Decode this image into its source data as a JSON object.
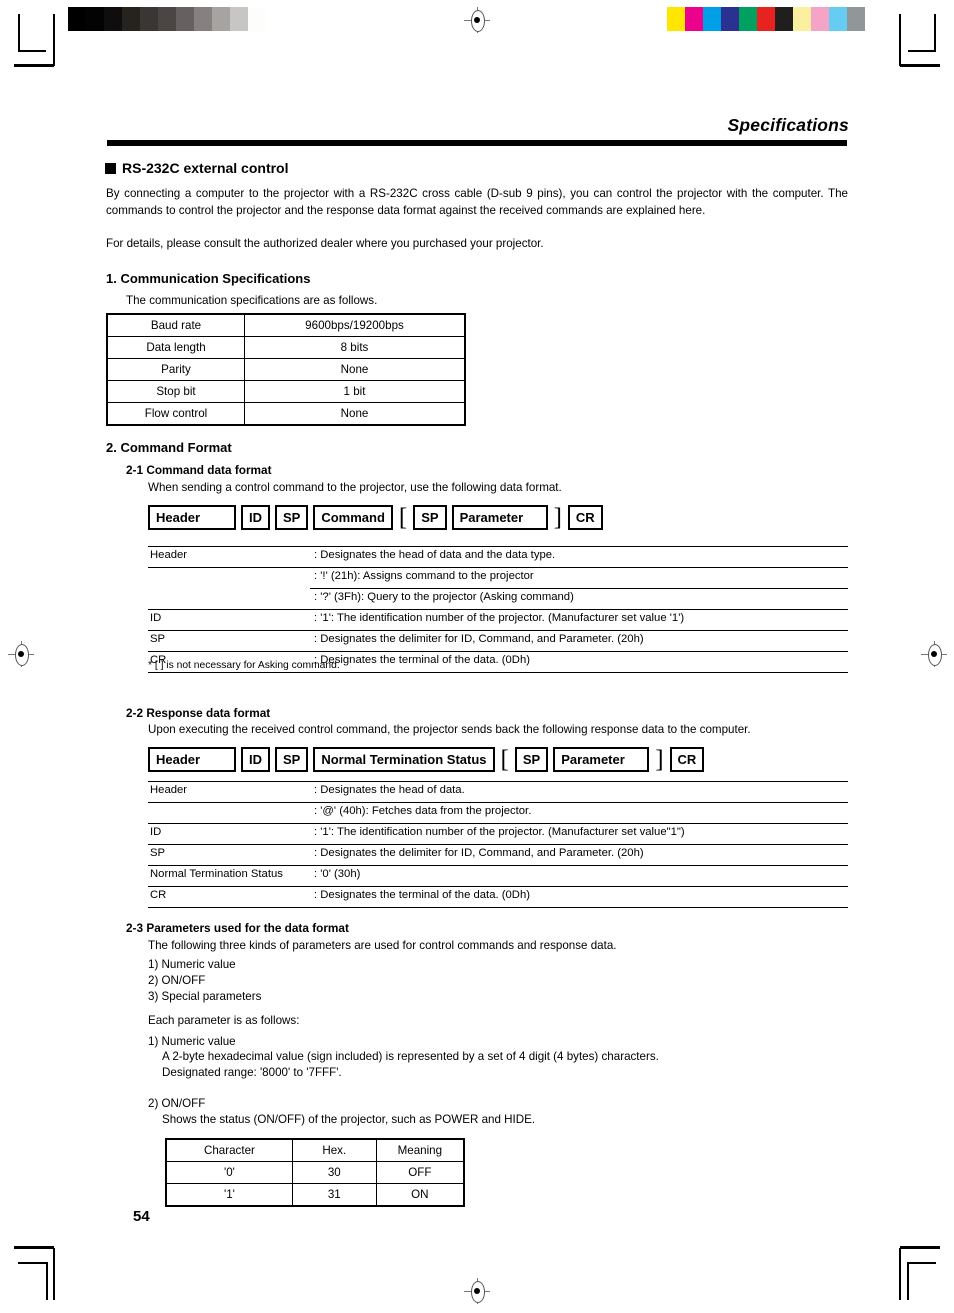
{
  "header": {
    "section_title": "Specifications"
  },
  "block": {
    "title": "RS-232C external control",
    "intro": "By connecting a computer to the projector with a RS-232C cross cable (D-sub 9 pins), you can control the projector with the computer. The commands to control the projector and the response data format against the received commands are explained here.",
    "intro2": "For details, please consult the authorized dealer where you purchased your projector."
  },
  "section1": {
    "heading": "1.  Communication Specifications",
    "lead": "The communication specifications are as follows.",
    "table": {
      "rows": [
        {
          "label": "Baud rate",
          "value": "9600bps/19200bps"
        },
        {
          "label": "Data length",
          "value": "8 bits"
        },
        {
          "label": "Parity",
          "value": "None"
        },
        {
          "label": "Stop bit",
          "value": "1 bit"
        },
        {
          "label": "Flow control",
          "value": "None"
        }
      ]
    }
  },
  "section2": {
    "heading": "2.  Command Format",
    "sub1": {
      "heading": "2-1 Command data format",
      "lead": "When sending a control command to the projector, use the following data format.",
      "diagram": {
        "header": "Header",
        "id": "ID",
        "sp1": "SP",
        "command": "Command",
        "lbracket": "[",
        "sp2": "SP",
        "parameter": "Parameter",
        "rbracket": "]",
        "cr": "CR"
      },
      "desc_rows": [
        {
          "label": "Header",
          "value": ": Designates the head of data and the data type."
        },
        {
          "label": "",
          "value": ": '!' (21h): Assigns command to the projector"
        },
        {
          "label": "",
          "value": ": '?' (3Fh): Query to the projector (Asking command)"
        },
        {
          "label": "ID",
          "value": ": '1': The identification number of the projector. (Manufacturer set value '1')"
        },
        {
          "label": "SP",
          "value": ": Designates the delimiter for ID, Command, and Parameter. (20h)"
        },
        {
          "label": "CR",
          "value": ": Designates the terminal of the data. (0Dh)"
        }
      ],
      "footnote": "* [  ] is not necessary for Asking command."
    },
    "sub2": {
      "heading": "2-2 Response data format",
      "lead": "Upon executing the received control command, the projector sends back the following response data to the computer.",
      "diagram": {
        "header": "Header",
        "id": "ID",
        "sp1": "SP",
        "status": "Normal Termination Status",
        "lbracket": "[",
        "sp2": "SP",
        "parameter": "Parameter",
        "rbracket": "]",
        "cr": "CR"
      },
      "desc_rows": [
        {
          "label": "Header",
          "value": ": Designates the head of data."
        },
        {
          "label": "",
          "value": ": '@' (40h): Fetches data from the projector."
        },
        {
          "label": "ID",
          "value": ": '1': The identification number of the projector. (Manufacturer set value\"1\")"
        },
        {
          "label": "SP",
          "value": ":  Designates the delimiter for ID, Command, and Parameter. (20h)"
        },
        {
          "label": "Normal Termination Status",
          "value": ": '0' (30h)"
        },
        {
          "label": "CR",
          "value": ": Designates the terminal of the data. (0Dh)"
        }
      ]
    },
    "sub3": {
      "heading": "2-3 Parameters used for the data format",
      "lead": "The following three kinds of parameters are used for control commands and response data.",
      "items": [
        "1)  Numeric value",
        "2)  ON/OFF",
        "3)  Special parameters"
      ],
      "each": "Each parameter is as follows:",
      "numeric_title": "1) Numeric value",
      "numeric_line1": "A 2-byte hexadecimal value (sign included) is represented by a set of 4 digit (4 bytes) characters.",
      "numeric_line2": "Designated range: '8000' to '7FFF'.",
      "onoff_title": "2) ON/OFF",
      "onoff_line": "Shows the status (ON/OFF) of the projector, such as POWER and HIDE.",
      "onoff_table": {
        "headers": [
          "Character",
          "Hex.",
          "Meaning"
        ],
        "rows": [
          [
            "'0'",
            "30",
            "OFF"
          ],
          [
            "'1'",
            "31",
            "ON"
          ]
        ]
      }
    }
  },
  "footer": {
    "page_number": "54"
  },
  "calibration": {
    "gray_bar": [
      "#000000",
      "#030303",
      "#0f0d0d",
      "#26231f",
      "#3a3633",
      "#4b4643",
      "#666060",
      "#868080",
      "#a6a3a1",
      "#c8c6c4",
      "#fdfefc"
    ],
    "color_bar": [
      "#ffe600",
      "#ec018c",
      "#00a0e9",
      "#2b3191",
      "#00a060",
      "#e8221f",
      "#211e1e",
      "#fbf0a0",
      "#f5a3c7",
      "#66ccf2",
      "#919699"
    ]
  }
}
